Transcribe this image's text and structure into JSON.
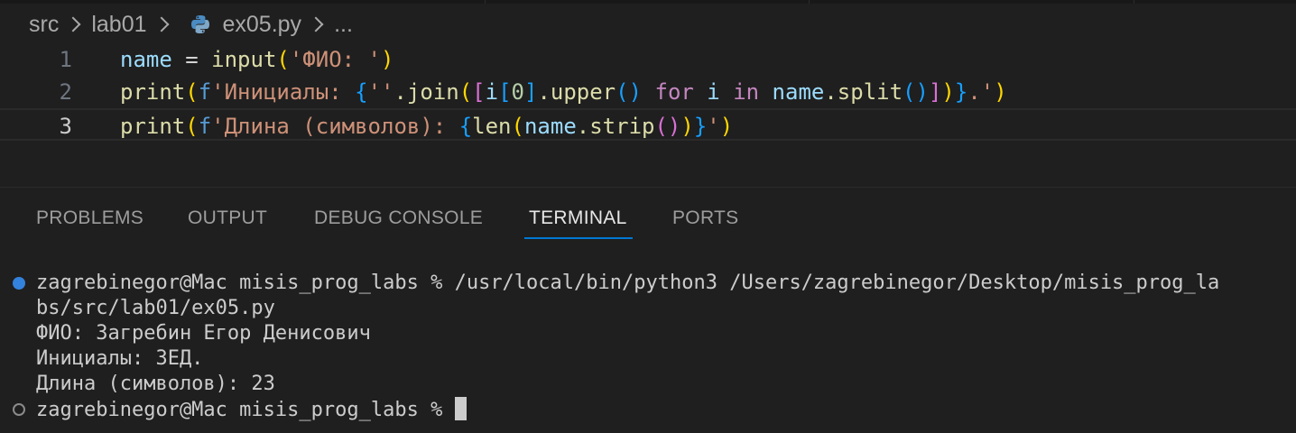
{
  "breadcrumb": {
    "items": [
      "src",
      "lab01",
      "ex05.py",
      "..."
    ]
  },
  "editor": {
    "lines": [
      {
        "number": "1"
      },
      {
        "number": "2"
      },
      {
        "number": "3"
      }
    ],
    "line1": {
      "var": "name",
      "eq": " = ",
      "fn": "input",
      "open": "(",
      "str": "'ФИО: '",
      "close": ")"
    },
    "line2": {
      "fn": "print",
      "open": "(",
      "fprefix": "f",
      "str1": "'Инициалы: ",
      "brace_open": "{",
      "str2": "''",
      "join": ".join",
      "p_open": "(",
      "sq_open": "[",
      "i1": "i",
      "sq2_open": "[",
      "zero": "0",
      "sq2_close": "]",
      "upper": ".upper",
      "upper_parens": "()",
      "for": " for ",
      "i2": "i",
      "in": " in ",
      "name": "name",
      "split": ".split",
      "split_parens": "()",
      "sq_close": "]",
      "p_close": ")",
      "brace_close": "}",
      "str3": ".'",
      "close": ")"
    },
    "line3": {
      "fn": "print",
      "open": "(",
      "fprefix": "f",
      "str1": "'Длина (символов): ",
      "brace_open": "{",
      "len": "len",
      "p_open": "(",
      "name": "name",
      "strip": ".strip",
      "strip_parens": "()",
      "p_close": ")",
      "brace_close": "}",
      "str2": "'",
      "close": ")"
    }
  },
  "panel": {
    "tabs": [
      "PROBLEMS",
      "OUTPUT",
      "DEBUG CONSOLE",
      "TERMINAL",
      "PORTS"
    ],
    "active_tab": "TERMINAL"
  },
  "terminal": {
    "lines": [
      "zagrebinegor@Mac misis_prog_labs % /usr/local/bin/python3 /Users/zagrebinegor/Desktop/misis_prog_la",
      "bs/src/lab01/ex05.py",
      "ФИО: Загребин Егор Денисович",
      "Инициалы: ЗЕД.",
      "Длина (символов): 23",
      "zagrebinegor@Mac misis_prog_labs % "
    ]
  },
  "colors": {
    "background": "#1f1f1f",
    "accent": "#0078d4",
    "status_dot": "#3794ff"
  }
}
